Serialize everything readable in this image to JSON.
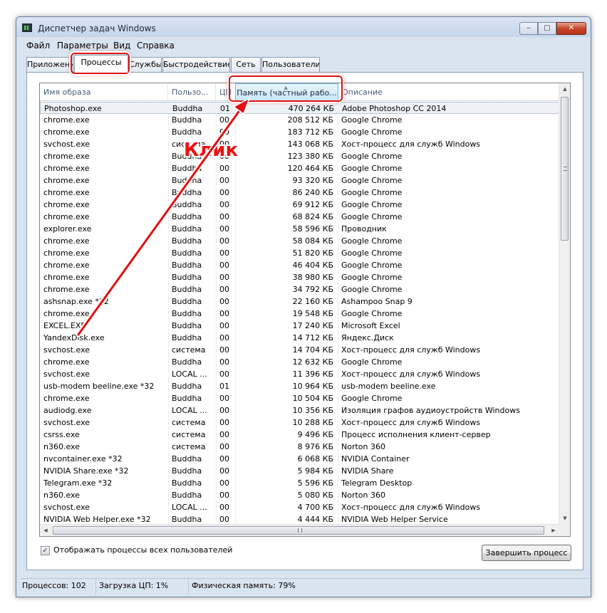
{
  "window": {
    "title": "Диспетчер задач Windows",
    "min_glyph": "‒",
    "max_glyph": "□",
    "close_glyph": "✕"
  },
  "menu": [
    "Файл",
    "Параметры",
    "Вид",
    "Справка"
  ],
  "tabs": [
    "Приложения",
    "Процессы",
    "Службы",
    "Быстродействие",
    "Сеть",
    "Пользователи"
  ],
  "active_tab": "Процессы",
  "columns": {
    "name": "Имя образа",
    "user": "Пользо...",
    "cpu": "ЦП",
    "memory": "Память (частный рабо...",
    "desc": "Описание"
  },
  "rows": [
    {
      "name": "Photoshop.exe",
      "user": "Buddha",
      "cpu": "01",
      "mem": "470 264 КБ",
      "desc": "Adobe Photoshop CC 2014"
    },
    {
      "name": "chrome.exe",
      "user": "Buddha",
      "cpu": "00",
      "mem": "208 512 КБ",
      "desc": "Google Chrome"
    },
    {
      "name": "chrome.exe",
      "user": "Buddha",
      "cpu": "00",
      "mem": "183 712 КБ",
      "desc": "Google Chrome"
    },
    {
      "name": "svchost.exe",
      "user": "система",
      "cpu": "00",
      "mem": "143 068 КБ",
      "desc": "Хост-процесс для служб Windows"
    },
    {
      "name": "chrome.exe",
      "user": "Buddha",
      "cpu": "00",
      "mem": "123 380 КБ",
      "desc": "Google Chrome"
    },
    {
      "name": "chrome.exe",
      "user": "Buddha",
      "cpu": "00",
      "mem": "120 464 КБ",
      "desc": "Google Chrome"
    },
    {
      "name": "chrome.exe",
      "user": "Buddha",
      "cpu": "00",
      "mem": "93 320 КБ",
      "desc": "Google Chrome"
    },
    {
      "name": "chrome.exe",
      "user": "Buddha",
      "cpu": "00",
      "mem": "86 240 КБ",
      "desc": "Google Chrome"
    },
    {
      "name": "chrome.exe",
      "user": "Buddha",
      "cpu": "00",
      "mem": "69 912 КБ",
      "desc": "Google Chrome"
    },
    {
      "name": "chrome.exe",
      "user": "Buddha",
      "cpu": "00",
      "mem": "68 824 КБ",
      "desc": "Google Chrome"
    },
    {
      "name": "explorer.exe",
      "user": "Buddha",
      "cpu": "00",
      "mem": "58 596 КБ",
      "desc": "Проводник"
    },
    {
      "name": "chrome.exe",
      "user": "Buddha",
      "cpu": "00",
      "mem": "58 084 КБ",
      "desc": "Google Chrome"
    },
    {
      "name": "chrome.exe",
      "user": "Buddha",
      "cpu": "00",
      "mem": "51 820 КБ",
      "desc": "Google Chrome"
    },
    {
      "name": "chrome.exe",
      "user": "Buddha",
      "cpu": "00",
      "mem": "46 404 КБ",
      "desc": "Google Chrome"
    },
    {
      "name": "chrome.exe",
      "user": "Buddha",
      "cpu": "00",
      "mem": "38 980 КБ",
      "desc": "Google Chrome"
    },
    {
      "name": "chrome.exe",
      "user": "Buddha",
      "cpu": "00",
      "mem": "34 792 КБ",
      "desc": "Google Chrome"
    },
    {
      "name": "ashsnap.exe *32",
      "user": "Buddha",
      "cpu": "00",
      "mem": "22 160 КБ",
      "desc": "Ashampoo Snap 9"
    },
    {
      "name": "chrome.exe",
      "user": "Buddha",
      "cpu": "00",
      "mem": "19 548 КБ",
      "desc": "Google Chrome"
    },
    {
      "name": "EXCEL.EXE",
      "user": "Buddha",
      "cpu": "00",
      "mem": "17 240 КБ",
      "desc": "Microsoft Excel"
    },
    {
      "name": "YandexDisk.exe",
      "user": "Buddha",
      "cpu": "00",
      "mem": "14 712 КБ",
      "desc": "Яндекс.Диск"
    },
    {
      "name": "svchost.exe",
      "user": "система",
      "cpu": "00",
      "mem": "14 704 КБ",
      "desc": "Хост-процесс для служб Windows"
    },
    {
      "name": "chrome.exe",
      "user": "Buddha",
      "cpu": "00",
      "mem": "12 632 КБ",
      "desc": "Google Chrome"
    },
    {
      "name": "svchost.exe",
      "user": "LOCAL ...",
      "cpu": "00",
      "mem": "11 396 КБ",
      "desc": "Хост-процесс для служб Windows"
    },
    {
      "name": "usb-modem beeline.exe *32",
      "user": "Buddha",
      "cpu": "01",
      "mem": "10 964 КБ",
      "desc": "usb-modem beeline.exe"
    },
    {
      "name": "chrome.exe",
      "user": "Buddha",
      "cpu": "00",
      "mem": "10 504 КБ",
      "desc": "Google Chrome"
    },
    {
      "name": "audiodg.exe",
      "user": "LOCAL ...",
      "cpu": "00",
      "mem": "10 356 КБ",
      "desc": "Изоляция графов аудиоустройств Windows"
    },
    {
      "name": "svchost.exe",
      "user": "система",
      "cpu": "00",
      "mem": "10 288 КБ",
      "desc": "Хост-процесс для служб Windows"
    },
    {
      "name": "csrss.exe",
      "user": "система",
      "cpu": "00",
      "mem": "9 496 КБ",
      "desc": "Процесс исполнения клиент-сервер"
    },
    {
      "name": "n360.exe",
      "user": "система",
      "cpu": "00",
      "mem": "8 976 КБ",
      "desc": "Norton 360"
    },
    {
      "name": "nvcontainer.exe *32",
      "user": "Buddha",
      "cpu": "00",
      "mem": "6 068 КБ",
      "desc": "NVIDIA Container"
    },
    {
      "name": "NVIDIA Share.exe *32",
      "user": "Buddha",
      "cpu": "00",
      "mem": "5 984 КБ",
      "desc": "NVIDIA Share"
    },
    {
      "name": "Telegram.exe *32",
      "user": "Buddha",
      "cpu": "00",
      "mem": "5 596 КБ",
      "desc": "Telegram Desktop"
    },
    {
      "name": "n360.exe",
      "user": "Buddha",
      "cpu": "00",
      "mem": "5 080 КБ",
      "desc": "Norton 360"
    },
    {
      "name": "svchost.exe",
      "user": "LOCAL ...",
      "cpu": "00",
      "mem": "4 700 КБ",
      "desc": "Хост-процесс для служб Windows"
    },
    {
      "name": "NVIDIA Web Helper.exe *32",
      "user": "Buddha",
      "cpu": "00",
      "mem": "4 444 КБ",
      "desc": "NVIDIA Web Helper Service"
    }
  ],
  "show_all_users": {
    "label": "Отображать процессы всех пользователей",
    "checked": true,
    "check_glyph": "✓"
  },
  "end_process_button": "Завершить процесс",
  "status": {
    "processes": "Процессов: 102",
    "cpu": "Загрузка ЦП: 1%",
    "memory": "Физическая память: 79%"
  },
  "annotation": {
    "text": "Клик"
  },
  "glyphs": {
    "up": "▲",
    "down": "▼",
    "left": "◀",
    "right": "▶",
    "sort": "▲"
  }
}
